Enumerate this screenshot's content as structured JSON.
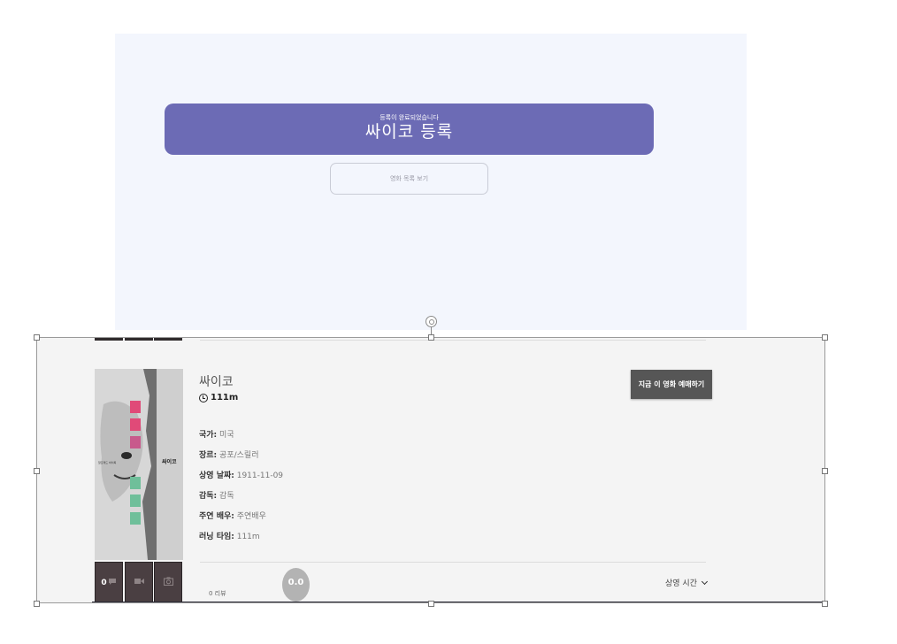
{
  "confirmation": {
    "subtitle": "등록이 완료되었습니다",
    "title": "싸이코 등록",
    "list_button": "영화 목록 보기",
    "colors": {
      "panel_bg": "#f3f6fd",
      "banner": "#6c6bb5"
    }
  },
  "movie": {
    "title": "싸이코",
    "runtime": "111m",
    "details": [
      {
        "key": "국가:",
        "value": "미국"
      },
      {
        "key": "장르:",
        "value": "공포/스릴러"
      },
      {
        "key": "상영 날짜:",
        "value": "1911-11-09"
      },
      {
        "key": "감독:",
        "value": "감독"
      },
      {
        "key": "주연 배우:",
        "value": "주연배우"
      },
      {
        "key": "러닝 타임:",
        "value": "111m"
      }
    ],
    "book_button": "지금 이 영화 예매하기",
    "poster": {
      "side_title": "싸이코",
      "side_tag": "알프레드 히치콕"
    },
    "thumbs": [
      {
        "icon": "comment-icon",
        "count": "0"
      },
      {
        "icon": "video-camera-icon"
      },
      {
        "icon": "camera-icon"
      }
    ],
    "review_count": "0 리뷰",
    "rating": "0.0",
    "showtime_label": "상영 시간"
  }
}
